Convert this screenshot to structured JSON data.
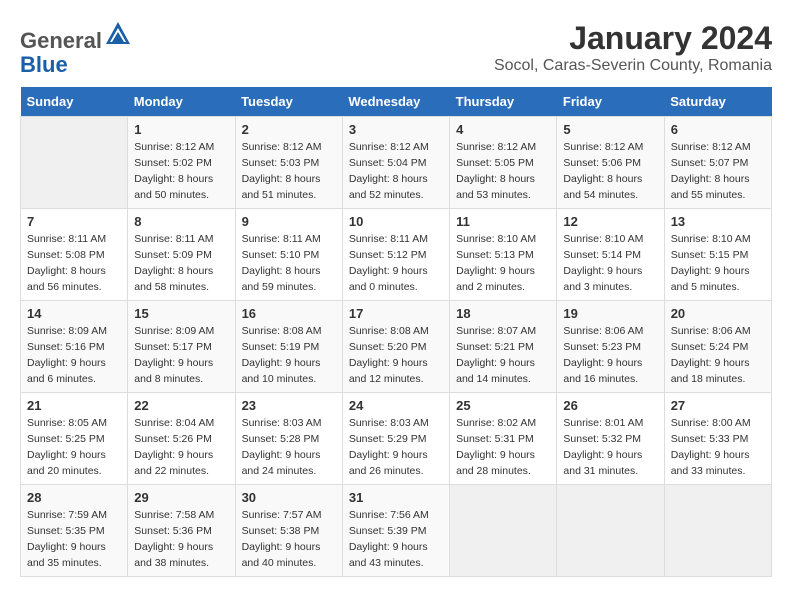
{
  "header": {
    "logo_general": "General",
    "logo_blue": "Blue",
    "month_title": "January 2024",
    "location": "Socol, Caras-Severin County, Romania"
  },
  "weekdays": [
    "Sunday",
    "Monday",
    "Tuesday",
    "Wednesday",
    "Thursday",
    "Friday",
    "Saturday"
  ],
  "weeks": [
    [
      {
        "day": "",
        "sunrise": "",
        "sunset": "",
        "daylight": ""
      },
      {
        "day": "1",
        "sunrise": "Sunrise: 8:12 AM",
        "sunset": "Sunset: 5:02 PM",
        "daylight": "Daylight: 8 hours and 50 minutes."
      },
      {
        "day": "2",
        "sunrise": "Sunrise: 8:12 AM",
        "sunset": "Sunset: 5:03 PM",
        "daylight": "Daylight: 8 hours and 51 minutes."
      },
      {
        "day": "3",
        "sunrise": "Sunrise: 8:12 AM",
        "sunset": "Sunset: 5:04 PM",
        "daylight": "Daylight: 8 hours and 52 minutes."
      },
      {
        "day": "4",
        "sunrise": "Sunrise: 8:12 AM",
        "sunset": "Sunset: 5:05 PM",
        "daylight": "Daylight: 8 hours and 53 minutes."
      },
      {
        "day": "5",
        "sunrise": "Sunrise: 8:12 AM",
        "sunset": "Sunset: 5:06 PM",
        "daylight": "Daylight: 8 hours and 54 minutes."
      },
      {
        "day": "6",
        "sunrise": "Sunrise: 8:12 AM",
        "sunset": "Sunset: 5:07 PM",
        "daylight": "Daylight: 8 hours and 55 minutes."
      }
    ],
    [
      {
        "day": "7",
        "sunrise": "Sunrise: 8:11 AM",
        "sunset": "Sunset: 5:08 PM",
        "daylight": "Daylight: 8 hours and 56 minutes."
      },
      {
        "day": "8",
        "sunrise": "Sunrise: 8:11 AM",
        "sunset": "Sunset: 5:09 PM",
        "daylight": "Daylight: 8 hours and 58 minutes."
      },
      {
        "day": "9",
        "sunrise": "Sunrise: 8:11 AM",
        "sunset": "Sunset: 5:10 PM",
        "daylight": "Daylight: 8 hours and 59 minutes."
      },
      {
        "day": "10",
        "sunrise": "Sunrise: 8:11 AM",
        "sunset": "Sunset: 5:12 PM",
        "daylight": "Daylight: 9 hours and 0 minutes."
      },
      {
        "day": "11",
        "sunrise": "Sunrise: 8:10 AM",
        "sunset": "Sunset: 5:13 PM",
        "daylight": "Daylight: 9 hours and 2 minutes."
      },
      {
        "day": "12",
        "sunrise": "Sunrise: 8:10 AM",
        "sunset": "Sunset: 5:14 PM",
        "daylight": "Daylight: 9 hours and 3 minutes."
      },
      {
        "day": "13",
        "sunrise": "Sunrise: 8:10 AM",
        "sunset": "Sunset: 5:15 PM",
        "daylight": "Daylight: 9 hours and 5 minutes."
      }
    ],
    [
      {
        "day": "14",
        "sunrise": "Sunrise: 8:09 AM",
        "sunset": "Sunset: 5:16 PM",
        "daylight": "Daylight: 9 hours and 6 minutes."
      },
      {
        "day": "15",
        "sunrise": "Sunrise: 8:09 AM",
        "sunset": "Sunset: 5:17 PM",
        "daylight": "Daylight: 9 hours and 8 minutes."
      },
      {
        "day": "16",
        "sunrise": "Sunrise: 8:08 AM",
        "sunset": "Sunset: 5:19 PM",
        "daylight": "Daylight: 9 hours and 10 minutes."
      },
      {
        "day": "17",
        "sunrise": "Sunrise: 8:08 AM",
        "sunset": "Sunset: 5:20 PM",
        "daylight": "Daylight: 9 hours and 12 minutes."
      },
      {
        "day": "18",
        "sunrise": "Sunrise: 8:07 AM",
        "sunset": "Sunset: 5:21 PM",
        "daylight": "Daylight: 9 hours and 14 minutes."
      },
      {
        "day": "19",
        "sunrise": "Sunrise: 8:06 AM",
        "sunset": "Sunset: 5:23 PM",
        "daylight": "Daylight: 9 hours and 16 minutes."
      },
      {
        "day": "20",
        "sunrise": "Sunrise: 8:06 AM",
        "sunset": "Sunset: 5:24 PM",
        "daylight": "Daylight: 9 hours and 18 minutes."
      }
    ],
    [
      {
        "day": "21",
        "sunrise": "Sunrise: 8:05 AM",
        "sunset": "Sunset: 5:25 PM",
        "daylight": "Daylight: 9 hours and 20 minutes."
      },
      {
        "day": "22",
        "sunrise": "Sunrise: 8:04 AM",
        "sunset": "Sunset: 5:26 PM",
        "daylight": "Daylight: 9 hours and 22 minutes."
      },
      {
        "day": "23",
        "sunrise": "Sunrise: 8:03 AM",
        "sunset": "Sunset: 5:28 PM",
        "daylight": "Daylight: 9 hours and 24 minutes."
      },
      {
        "day": "24",
        "sunrise": "Sunrise: 8:03 AM",
        "sunset": "Sunset: 5:29 PM",
        "daylight": "Daylight: 9 hours and 26 minutes."
      },
      {
        "day": "25",
        "sunrise": "Sunrise: 8:02 AM",
        "sunset": "Sunset: 5:31 PM",
        "daylight": "Daylight: 9 hours and 28 minutes."
      },
      {
        "day": "26",
        "sunrise": "Sunrise: 8:01 AM",
        "sunset": "Sunset: 5:32 PM",
        "daylight": "Daylight: 9 hours and 31 minutes."
      },
      {
        "day": "27",
        "sunrise": "Sunrise: 8:00 AM",
        "sunset": "Sunset: 5:33 PM",
        "daylight": "Daylight: 9 hours and 33 minutes."
      }
    ],
    [
      {
        "day": "28",
        "sunrise": "Sunrise: 7:59 AM",
        "sunset": "Sunset: 5:35 PM",
        "daylight": "Daylight: 9 hours and 35 minutes."
      },
      {
        "day": "29",
        "sunrise": "Sunrise: 7:58 AM",
        "sunset": "Sunset: 5:36 PM",
        "daylight": "Daylight: 9 hours and 38 minutes."
      },
      {
        "day": "30",
        "sunrise": "Sunrise: 7:57 AM",
        "sunset": "Sunset: 5:38 PM",
        "daylight": "Daylight: 9 hours and 40 minutes."
      },
      {
        "day": "31",
        "sunrise": "Sunrise: 7:56 AM",
        "sunset": "Sunset: 5:39 PM",
        "daylight": "Daylight: 9 hours and 43 minutes."
      },
      {
        "day": "",
        "sunrise": "",
        "sunset": "",
        "daylight": ""
      },
      {
        "day": "",
        "sunrise": "",
        "sunset": "",
        "daylight": ""
      },
      {
        "day": "",
        "sunrise": "",
        "sunset": "",
        "daylight": ""
      }
    ]
  ]
}
